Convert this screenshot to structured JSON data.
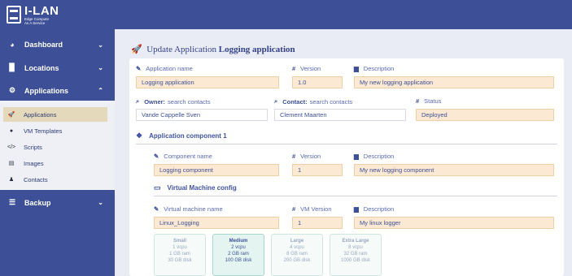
{
  "brand": {
    "title": "I-LAN",
    "subtitle_line1": "Edge Compute",
    "subtitle_line2": "As A Service"
  },
  "sidebar": {
    "items": [
      {
        "label": "Dashboard",
        "icon": "dashboard-icon"
      },
      {
        "label": "Locations",
        "icon": "building-icon"
      },
      {
        "label": "Applications",
        "icon": "cogs-icon"
      },
      {
        "label": "Backup",
        "icon": "database-icon"
      }
    ],
    "sub_items": [
      {
        "label": "Applications",
        "icon": "rocket-icon",
        "active": true
      },
      {
        "label": "VM Templates",
        "icon": "user-secret-icon"
      },
      {
        "label": "Scripts",
        "icon": "code-icon"
      },
      {
        "label": "Images",
        "icon": "hdd-icon"
      },
      {
        "label": "Contacts",
        "icon": "user-icon"
      }
    ]
  },
  "page": {
    "title_prefix": "Update Application",
    "title_name": "Logging application"
  },
  "app": {
    "name_label": "Application name",
    "name_value": "Logging application",
    "version_label": "Version",
    "version_value": "1.0",
    "description_label": "Description",
    "description_value": "My new logging application",
    "owner_label_bold": "Owner:",
    "owner_label_rest": "search contacts",
    "owner_value": "Vande Cappelle Sven",
    "contact_label_bold": "Contact:",
    "contact_label_rest": "search contacts",
    "contact_value": "Clement Maarten",
    "status_label": "Status",
    "status_value": "Deployed"
  },
  "component": {
    "section_title": "Application component 1",
    "name_label": "Component name",
    "name_value": "Logging component",
    "version_label": "Version",
    "version_value": "1",
    "description_label": "Description",
    "description_value": "My new logging component"
  },
  "vm": {
    "section_title": "Virtual Machine config",
    "name_label": "Virtual machine name",
    "name_value": "Linux_Logging",
    "version_label": "VM Version",
    "version_value": "1",
    "description_label": "Description",
    "description_value": "My linux logger",
    "sizes": [
      {
        "name": "Small",
        "cpu": "1 vcpu",
        "ram": "1 GB ram",
        "disk": "30 GB disk",
        "selected": false
      },
      {
        "name": "Medium",
        "cpu": "2 vcpu",
        "ram": "2 GB ram",
        "disk": "100 GB disk",
        "selected": true
      },
      {
        "name": "Large",
        "cpu": "4 vcpu",
        "ram": "8 GB ram",
        "disk": "200 GB disk",
        "selected": false
      },
      {
        "name": "Extra Large",
        "cpu": "8 vcpu",
        "ram": "32 GB ram",
        "disk": "1000 GB disk",
        "selected": false
      }
    ]
  },
  "colors": {
    "sidebar": "#3d4f96",
    "field_bg": "#fbe9d3",
    "active_sub": "#e4d9ba",
    "size_selected": "#e4f5f1"
  }
}
